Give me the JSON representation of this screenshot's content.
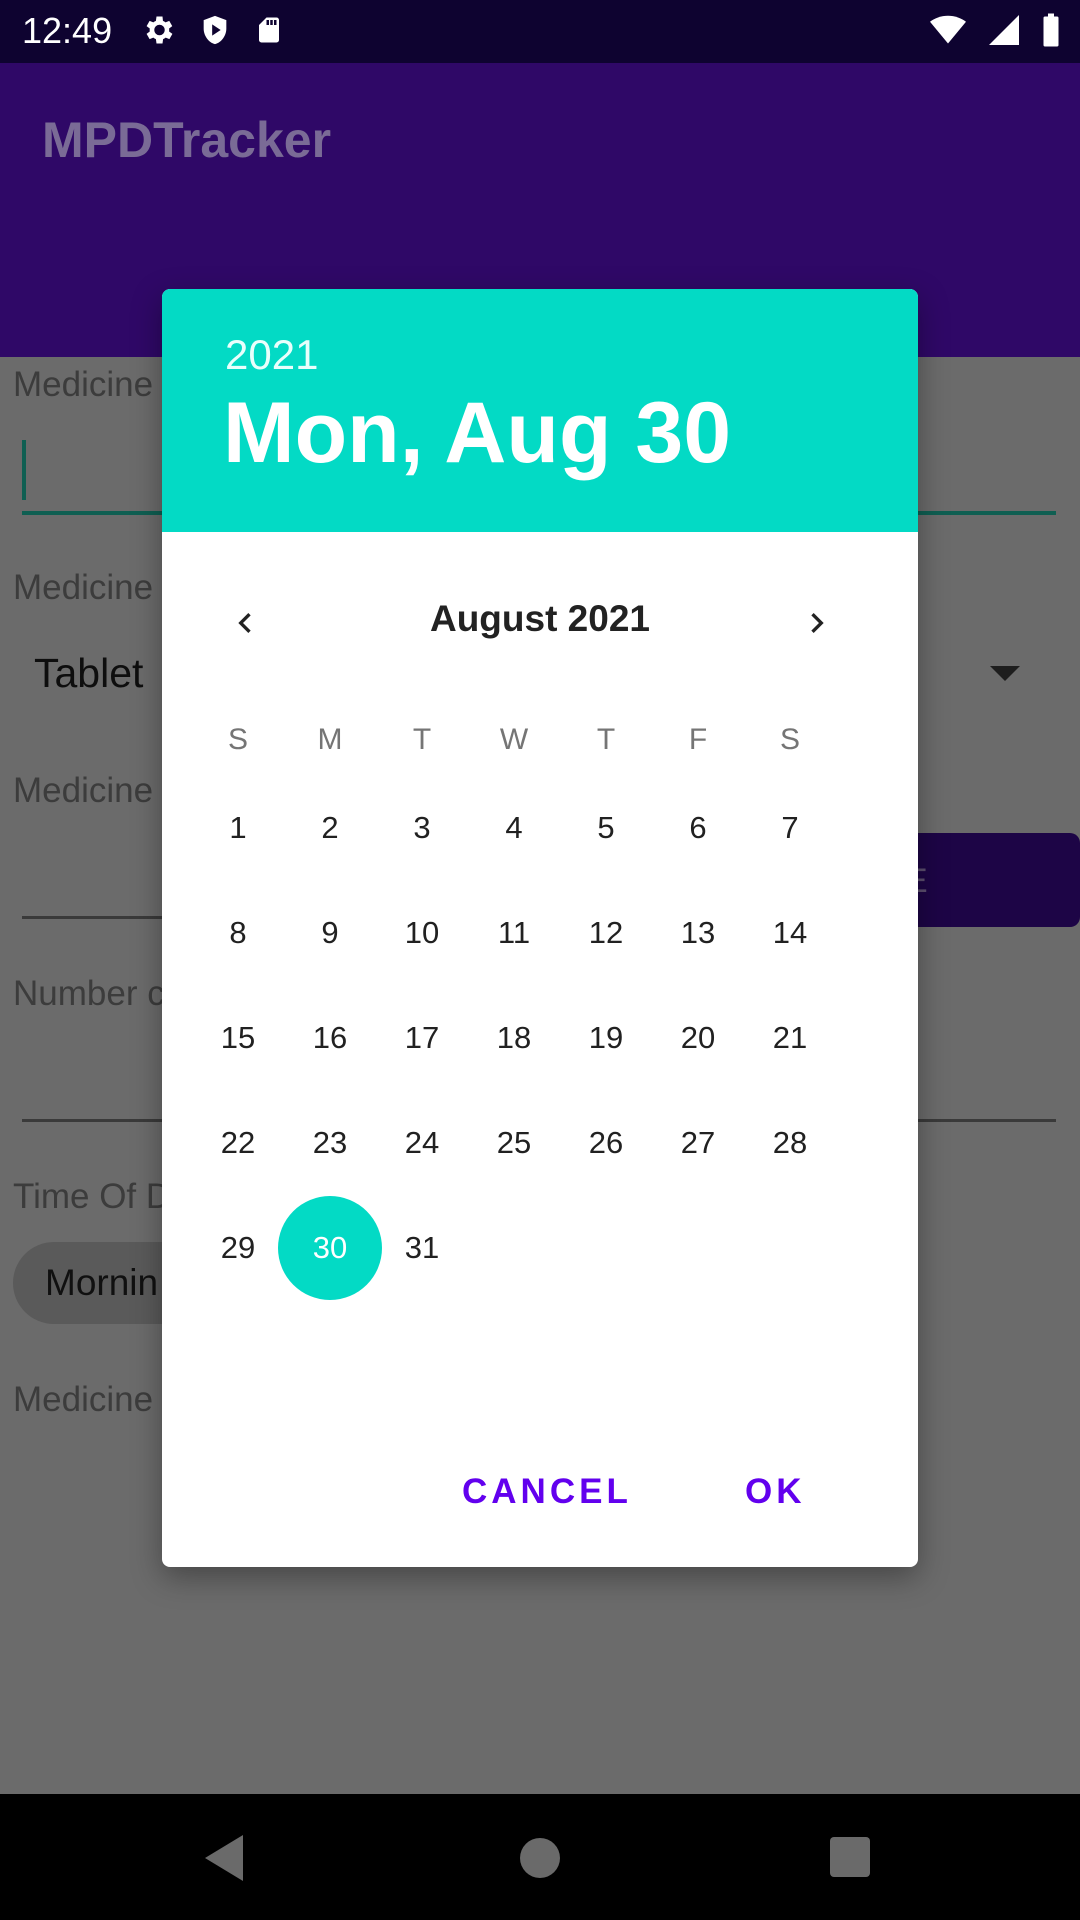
{
  "status_bar": {
    "time": "12:49",
    "left_icons": [
      "gear-icon",
      "shield-play-icon",
      "sd-card-icon"
    ],
    "right_icons": [
      "wifi-icon",
      "signal-icon",
      "battery-icon"
    ]
  },
  "app_bar": {
    "title": "MPDTracker",
    "color": "#2f0867"
  },
  "form": {
    "label_1": "Medicine",
    "label_2": "Medicine",
    "spinner_value": "Tablet",
    "label_3": "Medicine",
    "label_4": "Number c",
    "label_5": "Time Of D",
    "chip_text": "Mornin",
    "label_6": "Medicine",
    "button_text": "E"
  },
  "dialog": {
    "header_year": "2021",
    "header_date": "Mon, Aug 30",
    "month_title": "August 2021",
    "weekdays": [
      "S",
      "M",
      "T",
      "W",
      "T",
      "F",
      "S"
    ],
    "weeks": [
      [
        "1",
        "2",
        "3",
        "4",
        "5",
        "6",
        "7"
      ],
      [
        "8",
        "9",
        "10",
        "11",
        "12",
        "13",
        "14"
      ],
      [
        "15",
        "16",
        "17",
        "18",
        "19",
        "20",
        "21"
      ],
      [
        "22",
        "23",
        "24",
        "25",
        "26",
        "27",
        "28"
      ],
      [
        "29",
        "30",
        "31",
        "",
        "",
        "",
        ""
      ]
    ],
    "selected_day": "30",
    "cancel_label": "CANCEL",
    "ok_label": "OK",
    "accent_color": "#03dac5",
    "button_color": "#6200ee"
  }
}
